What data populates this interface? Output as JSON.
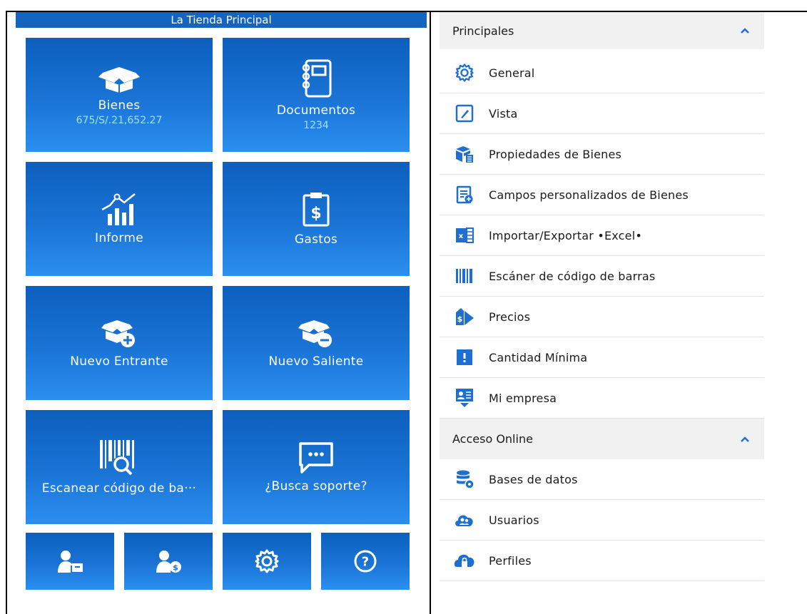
{
  "app": {
    "title": "La Tienda Principal"
  },
  "tiles": {
    "bienes": {
      "label": "Bienes",
      "sub": "675/S/.21,652.27"
    },
    "documentos": {
      "label": "Documentos",
      "sub": "1234"
    },
    "informe": {
      "label": "Informe"
    },
    "gastos": {
      "label": "Gastos"
    },
    "nuevo_entrante": {
      "label": "Nuevo Entrante"
    },
    "nuevo_saliente": {
      "label": "Nuevo Saliente"
    },
    "escanear": {
      "label": "Escanear código de ba···"
    },
    "soporte": {
      "label": "¿Busca soporte?"
    }
  },
  "bottom_icons": [
    "user-box-icon",
    "user-money-icon",
    "gear-icon",
    "help-icon"
  ],
  "principales": {
    "header": "Principales",
    "items": [
      {
        "label": "General",
        "icon": "gear-icon"
      },
      {
        "label": "Vista",
        "icon": "brush-icon"
      },
      {
        "label": "Propiedades de Bienes",
        "icon": "boxes-icon"
      },
      {
        "label": "Campos personalizados de Bienes",
        "icon": "form-add-icon"
      },
      {
        "label": "Importar/Exportar •Excel•",
        "icon": "excel-icon"
      },
      {
        "label": "Escáner de código de barras",
        "icon": "barcode-icon"
      },
      {
        "label": "Precios",
        "icon": "price-tag-icon"
      },
      {
        "label": "Cantidad Mínima",
        "icon": "alert-icon"
      },
      {
        "label": "Mi empresa",
        "icon": "company-icon"
      }
    ]
  },
  "acceso_online": {
    "header": "Acceso Online",
    "items": [
      {
        "label": "Bases de datos",
        "icon": "database-icon"
      },
      {
        "label": "Usuarios",
        "icon": "users-cloud-icon"
      },
      {
        "label": "Perfiles",
        "icon": "profile-lock-icon"
      }
    ]
  },
  "colors": {
    "tile_top": "#0d5fbd",
    "tile_bottom": "#2b8ff0",
    "accent": "#1565c0",
    "sub_text": "#9fe3ff"
  }
}
